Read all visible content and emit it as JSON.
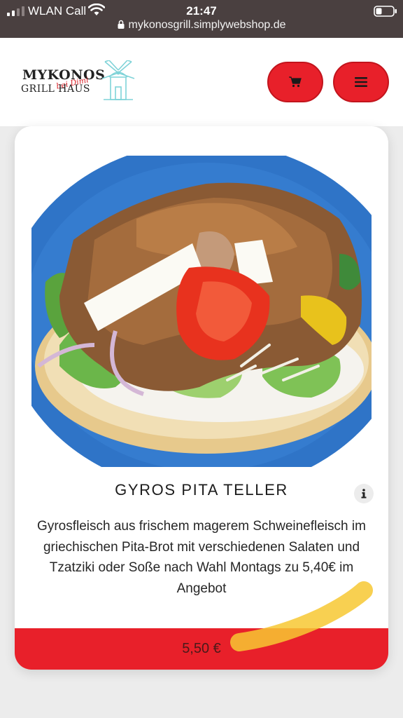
{
  "status_bar": {
    "carrier": "WLAN Call",
    "time": "21:47",
    "url": "mykonosgrill.simplywebshop.de"
  },
  "header": {
    "logo": {
      "line1": "MYKONOS",
      "line2": "bei Dimi",
      "line3": "GRILL HAUS"
    },
    "cart_icon": "shopping-cart-icon",
    "menu_icon": "hamburger-menu-icon"
  },
  "product": {
    "title": "GYROS PITA TELLER",
    "description": "Gyrosfleisch aus frischem magerem Schweinefleisch im griechischen Pita-Brot mit verschiedenen Salaten und Tzatziki oder Soße nach Wahl Montags zu 5,40€ im Angebot",
    "price": "5,50 €",
    "info_icon": "info-icon"
  },
  "colors": {
    "status_bar": "#4a4040",
    "brand_red": "#e8202a",
    "highlighter": "#f7c832"
  }
}
